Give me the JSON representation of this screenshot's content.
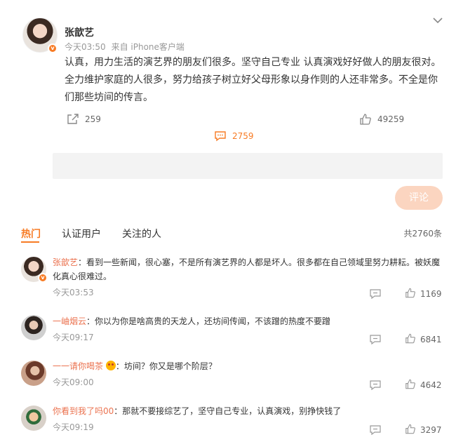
{
  "post": {
    "author": "张歆艺",
    "time": "今天03:50",
    "source": "来自 iPhone客户端",
    "text": "认真，用力生活的演艺界的朋友们很多。坚守自己专业 认真演戏好好做人的朋友很对。全力维护家庭的人很多，努力给孩子树立好父母形象以身作则的人还非常多。不全是你们那些坊间的传言。",
    "shares": "259",
    "comments": "2759",
    "likes": "49259"
  },
  "compose": {
    "submit_label": "评论"
  },
  "tabs": {
    "hot": "热门",
    "verified": "认证用户",
    "following": "关注的人"
  },
  "total": "共2760条",
  "comments": [
    {
      "user": "张歆艺",
      "text": "：看到一些新闻，很心塞，不是所有演艺界的人都是坏人。很多都在自己领域里努力耕耘。被妖魔化真心很难过。",
      "time": "今天03:53",
      "likes": "1169"
    },
    {
      "user": "一岫烟云",
      "text": "：你以为你是啥高贵的天龙人，还坊间传闻，不该蹭的热度不要蹭",
      "time": "今天09:17",
      "likes": "6841"
    },
    {
      "user": "一一请你喝茶",
      "text": "：坊间？你又是哪个阶层？",
      "time": "今天09:00",
      "likes": "4642"
    },
    {
      "user": "你看到我了吗00",
      "text": "：那就不要接综艺了，坚守自己专业，认真演戏，别挣快钱了",
      "time": "今天09:19",
      "likes": "3297"
    }
  ],
  "colors": {
    "accent": "#f77b24",
    "username": "#eb7350",
    "submit_bg": "#fbd5c0"
  },
  "icons": [
    "chevron-down-icon",
    "share-icon",
    "comment-icon",
    "like-icon",
    "reply-icon",
    "verified-badge-icon",
    "emoji-icon"
  ]
}
